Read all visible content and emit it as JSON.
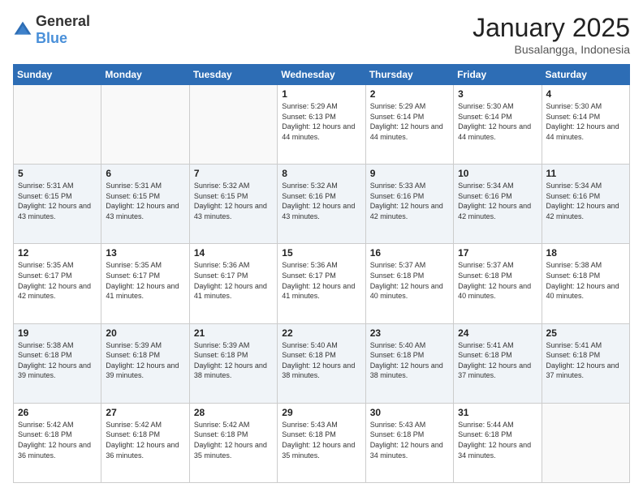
{
  "logo": {
    "general": "General",
    "blue": "Blue"
  },
  "header": {
    "title": "January 2025",
    "subtitle": "Busalangga, Indonesia"
  },
  "weekdays": [
    "Sunday",
    "Monday",
    "Tuesday",
    "Wednesday",
    "Thursday",
    "Friday",
    "Saturday"
  ],
  "weeks": [
    [
      {
        "day": "",
        "info": ""
      },
      {
        "day": "",
        "info": ""
      },
      {
        "day": "",
        "info": ""
      },
      {
        "day": "1",
        "info": "Sunrise: 5:29 AM\nSunset: 6:13 PM\nDaylight: 12 hours and 44 minutes."
      },
      {
        "day": "2",
        "info": "Sunrise: 5:29 AM\nSunset: 6:14 PM\nDaylight: 12 hours and 44 minutes."
      },
      {
        "day": "3",
        "info": "Sunrise: 5:30 AM\nSunset: 6:14 PM\nDaylight: 12 hours and 44 minutes."
      },
      {
        "day": "4",
        "info": "Sunrise: 5:30 AM\nSunset: 6:14 PM\nDaylight: 12 hours and 44 minutes."
      }
    ],
    [
      {
        "day": "5",
        "info": "Sunrise: 5:31 AM\nSunset: 6:15 PM\nDaylight: 12 hours and 43 minutes."
      },
      {
        "day": "6",
        "info": "Sunrise: 5:31 AM\nSunset: 6:15 PM\nDaylight: 12 hours and 43 minutes."
      },
      {
        "day": "7",
        "info": "Sunrise: 5:32 AM\nSunset: 6:15 PM\nDaylight: 12 hours and 43 minutes."
      },
      {
        "day": "8",
        "info": "Sunrise: 5:32 AM\nSunset: 6:16 PM\nDaylight: 12 hours and 43 minutes."
      },
      {
        "day": "9",
        "info": "Sunrise: 5:33 AM\nSunset: 6:16 PM\nDaylight: 12 hours and 42 minutes."
      },
      {
        "day": "10",
        "info": "Sunrise: 5:34 AM\nSunset: 6:16 PM\nDaylight: 12 hours and 42 minutes."
      },
      {
        "day": "11",
        "info": "Sunrise: 5:34 AM\nSunset: 6:16 PM\nDaylight: 12 hours and 42 minutes."
      }
    ],
    [
      {
        "day": "12",
        "info": "Sunrise: 5:35 AM\nSunset: 6:17 PM\nDaylight: 12 hours and 42 minutes."
      },
      {
        "day": "13",
        "info": "Sunrise: 5:35 AM\nSunset: 6:17 PM\nDaylight: 12 hours and 41 minutes."
      },
      {
        "day": "14",
        "info": "Sunrise: 5:36 AM\nSunset: 6:17 PM\nDaylight: 12 hours and 41 minutes."
      },
      {
        "day": "15",
        "info": "Sunrise: 5:36 AM\nSunset: 6:17 PM\nDaylight: 12 hours and 41 minutes."
      },
      {
        "day": "16",
        "info": "Sunrise: 5:37 AM\nSunset: 6:18 PM\nDaylight: 12 hours and 40 minutes."
      },
      {
        "day": "17",
        "info": "Sunrise: 5:37 AM\nSunset: 6:18 PM\nDaylight: 12 hours and 40 minutes."
      },
      {
        "day": "18",
        "info": "Sunrise: 5:38 AM\nSunset: 6:18 PM\nDaylight: 12 hours and 40 minutes."
      }
    ],
    [
      {
        "day": "19",
        "info": "Sunrise: 5:38 AM\nSunset: 6:18 PM\nDaylight: 12 hours and 39 minutes."
      },
      {
        "day": "20",
        "info": "Sunrise: 5:39 AM\nSunset: 6:18 PM\nDaylight: 12 hours and 39 minutes."
      },
      {
        "day": "21",
        "info": "Sunrise: 5:39 AM\nSunset: 6:18 PM\nDaylight: 12 hours and 38 minutes."
      },
      {
        "day": "22",
        "info": "Sunrise: 5:40 AM\nSunset: 6:18 PM\nDaylight: 12 hours and 38 minutes."
      },
      {
        "day": "23",
        "info": "Sunrise: 5:40 AM\nSunset: 6:18 PM\nDaylight: 12 hours and 38 minutes."
      },
      {
        "day": "24",
        "info": "Sunrise: 5:41 AM\nSunset: 6:18 PM\nDaylight: 12 hours and 37 minutes."
      },
      {
        "day": "25",
        "info": "Sunrise: 5:41 AM\nSunset: 6:18 PM\nDaylight: 12 hours and 37 minutes."
      }
    ],
    [
      {
        "day": "26",
        "info": "Sunrise: 5:42 AM\nSunset: 6:18 PM\nDaylight: 12 hours and 36 minutes."
      },
      {
        "day": "27",
        "info": "Sunrise: 5:42 AM\nSunset: 6:18 PM\nDaylight: 12 hours and 36 minutes."
      },
      {
        "day": "28",
        "info": "Sunrise: 5:42 AM\nSunset: 6:18 PM\nDaylight: 12 hours and 35 minutes."
      },
      {
        "day": "29",
        "info": "Sunrise: 5:43 AM\nSunset: 6:18 PM\nDaylight: 12 hours and 35 minutes."
      },
      {
        "day": "30",
        "info": "Sunrise: 5:43 AM\nSunset: 6:18 PM\nDaylight: 12 hours and 34 minutes."
      },
      {
        "day": "31",
        "info": "Sunrise: 5:44 AM\nSunset: 6:18 PM\nDaylight: 12 hours and 34 minutes."
      },
      {
        "day": "",
        "info": ""
      }
    ]
  ]
}
